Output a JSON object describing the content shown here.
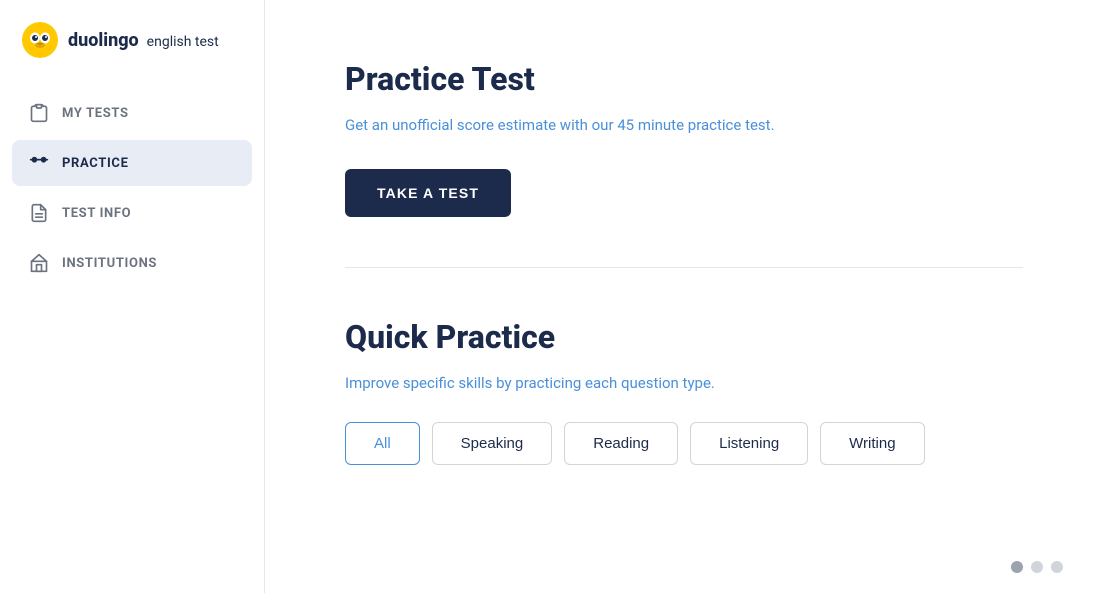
{
  "logo": {
    "brand": "duolingo",
    "product": "english test"
  },
  "sidebar": {
    "items": [
      {
        "id": "my-tests",
        "label": "MY TESTS",
        "icon": "clipboard-icon",
        "active": false
      },
      {
        "id": "practice",
        "label": "PRACTICE",
        "icon": "dumbbell-icon",
        "active": true
      },
      {
        "id": "test-info",
        "label": "TEST INFO",
        "icon": "document-icon",
        "active": false
      },
      {
        "id": "institutions",
        "label": "INSTITUTIONS",
        "icon": "building-icon",
        "active": false
      }
    ]
  },
  "practice_test": {
    "title": "Practice Test",
    "subtitle_plain": "Get an unofficial score estimate with our ",
    "subtitle_highlight": "45 minute",
    "subtitle_end": " practice test.",
    "button_label": "TAKE A TEST"
  },
  "quick_practice": {
    "title": "Quick Practice",
    "subtitle": "Improve specific skills by practicing each question type.",
    "filter_tabs": [
      {
        "id": "all",
        "label": "All",
        "active": true
      },
      {
        "id": "speaking",
        "label": "Speaking",
        "active": false
      },
      {
        "id": "reading",
        "label": "Reading",
        "active": false
      },
      {
        "id": "listening",
        "label": "Listening",
        "active": false
      },
      {
        "id": "writing",
        "label": "Writing",
        "active": false
      }
    ]
  },
  "pagination": {
    "dots": [
      {
        "active": true
      },
      {
        "active": false
      },
      {
        "active": false
      }
    ]
  }
}
